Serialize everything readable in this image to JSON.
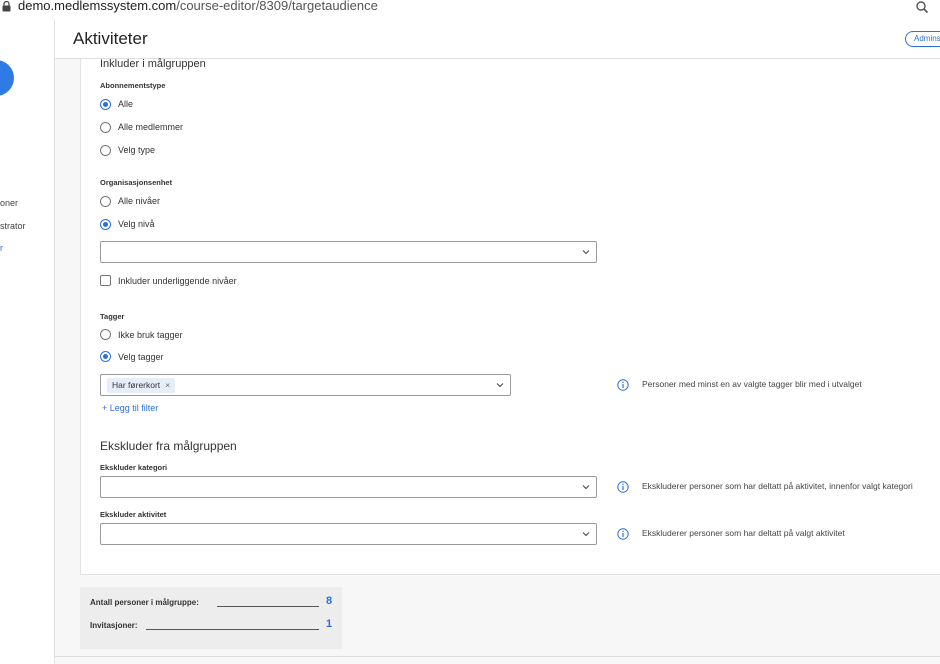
{
  "browser": {
    "url_host": "demo.medlemssystem.com",
    "url_path": "/course-editor/8309/targetaudience"
  },
  "sidebar": {
    "items": [
      {
        "label": "oner"
      },
      {
        "label": "strator"
      },
      {
        "label": "r"
      }
    ]
  },
  "header": {
    "title": "Aktiviteter",
    "admin_label": "Admins"
  },
  "include": {
    "title": "Inkluder i målgruppen",
    "subscription": {
      "label": "Abonnementstype",
      "options": [
        "Alle",
        "Alle medlemmer",
        "Velg type"
      ],
      "selected": "Alle"
    },
    "org_unit": {
      "label": "Organisasjonsenhet",
      "options": [
        "Alle nivåer",
        "Velg nivå"
      ],
      "selected": "Velg nivå",
      "select_value": "",
      "include_sublevels_label": "Inkluder underliggende nivåer",
      "include_sublevels_checked": false
    },
    "tags": {
      "label": "Tagger",
      "options": [
        "Ikke bruk tagger",
        "Velg tagger"
      ],
      "selected": "Velg tagger",
      "chips": [
        "Har førerkort"
      ],
      "chip_remove": "×",
      "info": "Personer med minst en av valgte tagger blir med i utvalget",
      "add_filter": "+ Legg til filter"
    }
  },
  "exclude": {
    "title": "Ekskluder fra målgruppen",
    "category": {
      "label": "Ekskluder kategori",
      "value": "",
      "info": "Ekskluderer personer som har deltatt på aktivitet, innenfor valgt kategori"
    },
    "activity": {
      "label": "Ekskluder aktivitet",
      "value": "",
      "info": "Ekskluderer personer som har deltatt på valgt aktivitet"
    }
  },
  "summary": {
    "persons_label": "Antall personer i målgruppe:",
    "persons_count": "8",
    "invitations_label": "Invitasjoner:",
    "invitations_count": "1"
  },
  "colors": {
    "accent": "#2e6fd9",
    "avatar": "#2e7be6"
  }
}
